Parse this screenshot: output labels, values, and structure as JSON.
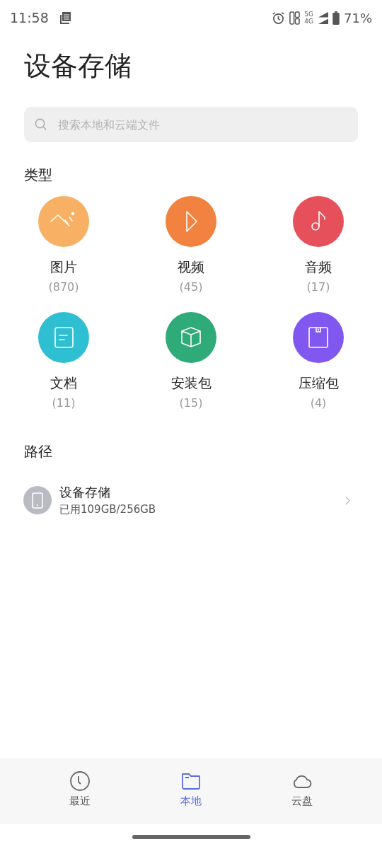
{
  "status_bar": {
    "time": "11:58",
    "network_top": "5G",
    "network_bottom": "4G",
    "battery": "71%"
  },
  "title": "设备存储",
  "search": {
    "placeholder": "搜索本地和云端文件"
  },
  "types_heading": "类型",
  "categories": [
    {
      "kind": "image",
      "label": "图片",
      "count": "(870)",
      "color": "#f7b064"
    },
    {
      "kind": "video",
      "label": "视频",
      "count": "(45)",
      "color": "#f2823f"
    },
    {
      "kind": "audio",
      "label": "音频",
      "count": "(17)",
      "color": "#e5505a"
    },
    {
      "kind": "document",
      "label": "文档",
      "count": "(11)",
      "color": "#2fbfd3"
    },
    {
      "kind": "package",
      "label": "安装包",
      "count": "(15)",
      "color": "#2eab78"
    },
    {
      "kind": "archive",
      "label": "压缩包",
      "count": "(4)",
      "color": "#8058f0"
    }
  ],
  "path_heading": "路径",
  "storage": {
    "name": "设备存储",
    "usage": "已用109GB/256GB"
  },
  "tabs": [
    {
      "kind": "recent",
      "label": "最近",
      "selected": false
    },
    {
      "kind": "local",
      "label": "本地",
      "selected": true
    },
    {
      "kind": "cloud",
      "label": "云盘",
      "selected": false
    }
  ]
}
